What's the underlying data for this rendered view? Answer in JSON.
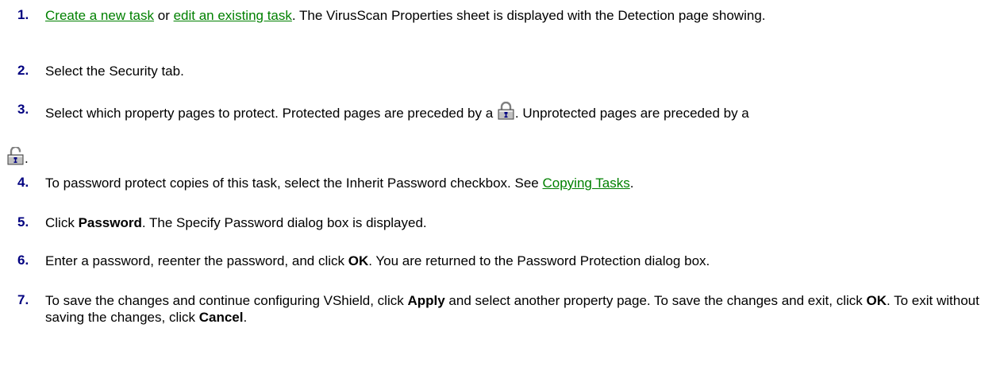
{
  "steps": [
    {
      "number": "1.",
      "link1": "Create a new task",
      "or": " or ",
      "link2": "edit an existing task",
      "rest": ". The VirusScan Properties sheet is displayed with the Detection page showing."
    },
    {
      "number": "2.",
      "text": "Select the Security tab."
    },
    {
      "number": "3.",
      "text_a": "Select which property pages to protect. Protected pages are preceded by a ",
      "text_b": ". Unprotected pages are preceded by a",
      "after_lock": "."
    },
    {
      "number": "4.",
      "text": "To password protect copies of this task, select the Inherit Password checkbox. See ",
      "link": "Copying Tasks",
      "after": "."
    },
    {
      "number": "5.",
      "pre": "Click ",
      "bold": "Password",
      "post": ". The Specify Password dialog box is displayed."
    },
    {
      "number": "6.",
      "pre": "Enter a password, reenter the password, and click ",
      "bold": "OK",
      "post": ". You are returned to the Password Protection dialog box."
    },
    {
      "number": "7.",
      "a": "To save the changes and continue configuring VShield, click ",
      "b": "Apply",
      "c": " and select another property page. To save the changes and exit, click ",
      "d": "OK",
      "e": ". To exit without saving the changes, click ",
      "f": "Cancel",
      "g": "."
    }
  ],
  "icons": {
    "protected": "locked-padlock-icon",
    "unprotected": "unlocked-padlock-icon"
  },
  "colors": {
    "number": "#000080",
    "link": "#008000"
  }
}
